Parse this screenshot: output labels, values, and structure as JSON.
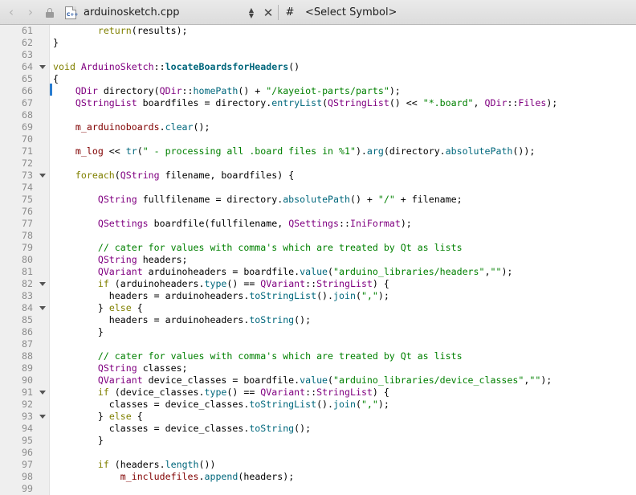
{
  "toolbar": {
    "back_glyph": "‹",
    "forward_glyph": "›",
    "file_name": "arduinosketch.cpp",
    "file_icon_label": "C++",
    "hash": "#",
    "symbol_placeholder": "<Select Symbol>",
    "icons": [
      "back-arrow-icon",
      "forward-arrow-icon",
      "lock-icon",
      "cpp-file-icon",
      "updown-arrows-icon",
      "close-icon"
    ]
  },
  "editor": {
    "colors": {
      "keyword": "#808000",
      "type": "#800080",
      "function": "#00677c",
      "string": "#008000",
      "comment": "#008000",
      "member": "#800000",
      "line_number": "#8c8c8c",
      "gutter": "#efefef",
      "change_marker": "#2a7dd0"
    },
    "lines": [
      {
        "n": "61",
        "fold": false,
        "tokens": [
          [
            "",
            "        "
          ],
          [
            "kw",
            "return"
          ],
          [
            "",
            "(results);"
          ]
        ]
      },
      {
        "n": "62",
        "fold": false,
        "tokens": [
          [
            "",
            "}"
          ]
        ]
      },
      {
        "n": "63",
        "fold": false,
        "tokens": []
      },
      {
        "n": "64",
        "fold": true,
        "tokens": [
          [
            "kw",
            "void"
          ],
          [
            "",
            " "
          ],
          [
            "ty",
            "ArduinoSketch"
          ],
          [
            "",
            "::"
          ],
          [
            "fd",
            "locateBoardsforHeaders"
          ],
          [
            "",
            "()"
          ]
        ]
      },
      {
        "n": "65",
        "fold": false,
        "tokens": [
          [
            "",
            "{"
          ]
        ]
      },
      {
        "n": "66",
        "fold": false,
        "tokens": [
          [
            "",
            "    "
          ],
          [
            "ty",
            "QDir"
          ],
          [
            "",
            " directory("
          ],
          [
            "ty",
            "QDir"
          ],
          [
            "",
            "::"
          ],
          [
            "fn",
            "homePath"
          ],
          [
            "",
            "() + "
          ],
          [
            "st",
            "\"/kayeiot-parts/parts\""
          ],
          [
            "",
            ");"
          ]
        ]
      },
      {
        "n": "67",
        "fold": false,
        "tokens": [
          [
            "",
            "    "
          ],
          [
            "ty",
            "QStringList"
          ],
          [
            "",
            " boardfiles = directory."
          ],
          [
            "fn",
            "entryList"
          ],
          [
            "",
            "("
          ],
          [
            "ty",
            "QStringList"
          ],
          [
            "",
            "() << "
          ],
          [
            "st",
            "\"*.board\""
          ],
          [
            "",
            ", "
          ],
          [
            "ty",
            "QDir"
          ],
          [
            "",
            "::"
          ],
          [
            "ty",
            "Files"
          ],
          [
            "",
            ");"
          ]
        ]
      },
      {
        "n": "68",
        "fold": false,
        "tokens": []
      },
      {
        "n": "69",
        "fold": false,
        "tokens": [
          [
            "",
            "    "
          ],
          [
            "mb",
            "m_arduinoboards"
          ],
          [
            "",
            "."
          ],
          [
            "fn",
            "clear"
          ],
          [
            "",
            "();"
          ]
        ]
      },
      {
        "n": "70",
        "fold": false,
        "tokens": []
      },
      {
        "n": "71",
        "fold": false,
        "tokens": [
          [
            "",
            "    "
          ],
          [
            "mb",
            "m_log"
          ],
          [
            "",
            " << "
          ],
          [
            "fn",
            "tr"
          ],
          [
            "",
            "("
          ],
          [
            "st",
            "\" - processing all .board files in %1\""
          ],
          [
            "",
            ")."
          ],
          [
            "fn",
            "arg"
          ],
          [
            "",
            "(directory."
          ],
          [
            "fn",
            "absolutePath"
          ],
          [
            "",
            "());"
          ]
        ]
      },
      {
        "n": "72",
        "fold": false,
        "tokens": []
      },
      {
        "n": "73",
        "fold": true,
        "tokens": [
          [
            "",
            "    "
          ],
          [
            "kw",
            "foreach"
          ],
          [
            "",
            "("
          ],
          [
            "ty",
            "QString"
          ],
          [
            "",
            " filename, boardfiles) {"
          ]
        ]
      },
      {
        "n": "74",
        "fold": false,
        "tokens": []
      },
      {
        "n": "75",
        "fold": false,
        "tokens": [
          [
            "",
            "        "
          ],
          [
            "ty",
            "QString"
          ],
          [
            "",
            " fullfilename = directory."
          ],
          [
            "fn",
            "absolutePath"
          ],
          [
            "",
            "() + "
          ],
          [
            "st",
            "\"/\""
          ],
          [
            "",
            " + filename;"
          ]
        ]
      },
      {
        "n": "76",
        "fold": false,
        "tokens": []
      },
      {
        "n": "77",
        "fold": false,
        "tokens": [
          [
            "",
            "        "
          ],
          [
            "ty",
            "QSettings"
          ],
          [
            "",
            " boardfile(fullfilename, "
          ],
          [
            "ty",
            "QSettings"
          ],
          [
            "",
            "::"
          ],
          [
            "ty",
            "IniFormat"
          ],
          [
            "",
            ");"
          ]
        ]
      },
      {
        "n": "78",
        "fold": false,
        "tokens": []
      },
      {
        "n": "79",
        "fold": false,
        "tokens": [
          [
            "",
            "        "
          ],
          [
            "cm",
            "// cater for values with comma's which are treated by Qt as lists"
          ]
        ]
      },
      {
        "n": "80",
        "fold": false,
        "tokens": [
          [
            "",
            "        "
          ],
          [
            "ty",
            "QString"
          ],
          [
            "",
            " headers;"
          ]
        ]
      },
      {
        "n": "81",
        "fold": false,
        "tokens": [
          [
            "",
            "        "
          ],
          [
            "ty",
            "QVariant"
          ],
          [
            "",
            " arduinoheaders = boardfile."
          ],
          [
            "fn",
            "value"
          ],
          [
            "",
            "("
          ],
          [
            "st",
            "\"arduino_libraries/headers\""
          ],
          [
            "",
            ","
          ],
          [
            "st",
            "\"\""
          ],
          [
            "",
            ");"
          ]
        ]
      },
      {
        "n": "82",
        "fold": true,
        "tokens": [
          [
            "",
            "        "
          ],
          [
            "kw",
            "if"
          ],
          [
            "",
            " (arduinoheaders."
          ],
          [
            "fn",
            "type"
          ],
          [
            "",
            "() == "
          ],
          [
            "ty",
            "QVariant"
          ],
          [
            "",
            "::"
          ],
          [
            "ty",
            "StringList"
          ],
          [
            "",
            ") {"
          ]
        ]
      },
      {
        "n": "83",
        "fold": false,
        "tokens": [
          [
            "",
            "          headers = arduinoheaders."
          ],
          [
            "fn",
            "toStringList"
          ],
          [
            "",
            "()."
          ],
          [
            "fn",
            "join"
          ],
          [
            "",
            "("
          ],
          [
            "st",
            "\",\""
          ],
          [
            "",
            ");"
          ]
        ]
      },
      {
        "n": "84",
        "fold": true,
        "tokens": [
          [
            "",
            "        } "
          ],
          [
            "kw",
            "else"
          ],
          [
            "",
            " {"
          ]
        ]
      },
      {
        "n": "85",
        "fold": false,
        "tokens": [
          [
            "",
            "          headers = arduinoheaders."
          ],
          [
            "fn",
            "toString"
          ],
          [
            "",
            "();"
          ]
        ]
      },
      {
        "n": "86",
        "fold": false,
        "tokens": [
          [
            "",
            "        }"
          ]
        ]
      },
      {
        "n": "87",
        "fold": false,
        "tokens": []
      },
      {
        "n": "88",
        "fold": false,
        "tokens": [
          [
            "",
            "        "
          ],
          [
            "cm",
            "// cater for values with comma's which are treated by Qt as lists"
          ]
        ]
      },
      {
        "n": "89",
        "fold": false,
        "tokens": [
          [
            "",
            "        "
          ],
          [
            "ty",
            "QString"
          ],
          [
            "",
            " classes;"
          ]
        ]
      },
      {
        "n": "90",
        "fold": false,
        "tokens": [
          [
            "",
            "        "
          ],
          [
            "ty",
            "QVariant"
          ],
          [
            "",
            " device_classes = boardfile."
          ],
          [
            "fn",
            "value"
          ],
          [
            "",
            "("
          ],
          [
            "st",
            "\"arduino_libraries/device_classes\""
          ],
          [
            "",
            ","
          ],
          [
            "st",
            "\"\""
          ],
          [
            "",
            ");"
          ]
        ]
      },
      {
        "n": "91",
        "fold": true,
        "tokens": [
          [
            "",
            "        "
          ],
          [
            "kw",
            "if"
          ],
          [
            "",
            " (device_classes."
          ],
          [
            "fn",
            "type"
          ],
          [
            "",
            "() == "
          ],
          [
            "ty",
            "QVariant"
          ],
          [
            "",
            "::"
          ],
          [
            "ty",
            "StringList"
          ],
          [
            "",
            ") {"
          ]
        ]
      },
      {
        "n": "92",
        "fold": false,
        "tokens": [
          [
            "",
            "          classes = device_classes."
          ],
          [
            "fn",
            "toStringList"
          ],
          [
            "",
            "()."
          ],
          [
            "fn",
            "join"
          ],
          [
            "",
            "("
          ],
          [
            "st",
            "\",\""
          ],
          [
            "",
            ");"
          ]
        ]
      },
      {
        "n": "93",
        "fold": true,
        "tokens": [
          [
            "",
            "        } "
          ],
          [
            "kw",
            "else"
          ],
          [
            "",
            " {"
          ]
        ]
      },
      {
        "n": "94",
        "fold": false,
        "tokens": [
          [
            "",
            "          classes = device_classes."
          ],
          [
            "fn",
            "toString"
          ],
          [
            "",
            "();"
          ]
        ]
      },
      {
        "n": "95",
        "fold": false,
        "tokens": [
          [
            "",
            "        }"
          ]
        ]
      },
      {
        "n": "96",
        "fold": false,
        "tokens": []
      },
      {
        "n": "97",
        "fold": false,
        "tokens": [
          [
            "",
            "        "
          ],
          [
            "kw",
            "if"
          ],
          [
            "",
            " (headers."
          ],
          [
            "fn",
            "length"
          ],
          [
            "",
            "())"
          ]
        ]
      },
      {
        "n": "98",
        "fold": false,
        "tokens": [
          [
            "",
            "            "
          ],
          [
            "mb",
            "m_includefiles"
          ],
          [
            "",
            "."
          ],
          [
            "fn",
            "append"
          ],
          [
            "",
            "(headers);"
          ]
        ]
      },
      {
        "n": "99",
        "fold": false,
        "tokens": []
      }
    ]
  }
}
